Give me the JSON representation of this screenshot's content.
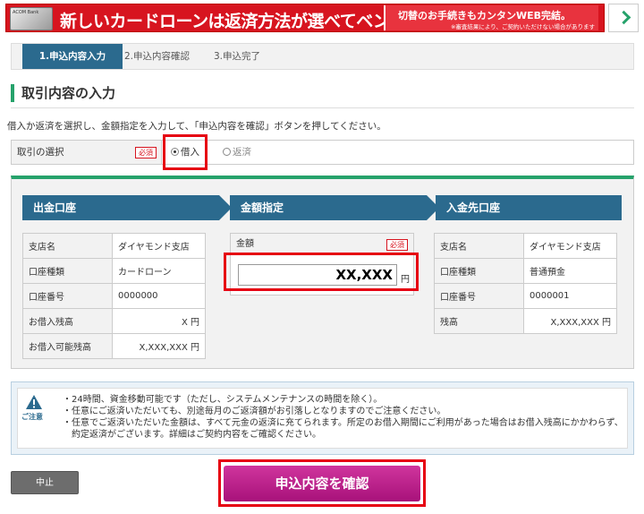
{
  "banner": {
    "card_text": "ACOM Bank",
    "headline": "新しいカードローンは返済方法が選べてベンリ！",
    "right_line1": "切替のお手続きもカンタンWEB完結。",
    "right_line2": "※審査結果により、ご契約いただけない場合があります"
  },
  "steps": [
    {
      "label": "1.申込内容入力"
    },
    {
      "label": "2.申込内容確認"
    },
    {
      "label": "3.申込完了"
    }
  ],
  "section_title": "取引内容の入力",
  "description": "借入か返済を選択し、金額指定を入力して、「申込内容を確認」ボタンを押してください。",
  "selection": {
    "label": "取引の選択",
    "required": "必須",
    "options": [
      {
        "label": "借入",
        "selected": true
      },
      {
        "label": "返済",
        "selected": false
      }
    ]
  },
  "withdraw": {
    "header": "出金口座",
    "rows": [
      {
        "key": "支店名",
        "value": "ダイヤモンド支店"
      },
      {
        "key": "口座種類",
        "value": "カードローン"
      },
      {
        "key": "口座番号",
        "value": "0000000"
      },
      {
        "key": "お借入残高",
        "value": "X 円"
      },
      {
        "key": "お借入可能残高",
        "value": "X,XXX,XXX 円"
      }
    ]
  },
  "amount": {
    "header": "金額指定",
    "label": "金額",
    "required": "必須",
    "value": "XX,XXX",
    "unit": "円"
  },
  "deposit": {
    "header": "入金先口座",
    "rows": [
      {
        "key": "支店名",
        "value": "ダイヤモンド支店"
      },
      {
        "key": "口座種類",
        "value": "普通預金"
      },
      {
        "key": "口座番号",
        "value": "0000001"
      },
      {
        "key": "残高",
        "value": "X,XXX,XXX 円"
      }
    ]
  },
  "notice": {
    "label": "ご注意",
    "items": [
      "・24時間、資金移動可能です（ただし、システムメンテナンスの時間を除く）。",
      "・任意にご返済いただいても、別途毎月のご返済額がお引落しとなりますのでご注意ください。",
      "・任意でご返済いただいた金額は、すべて元金の返済に充てられます。所定のお借入期間にご利用があった場合はお借入残高にかかわらず、約定返済がございます。詳細はご契約内容をご確認ください。"
    ]
  },
  "buttons": {
    "cancel": "中止",
    "confirm": "申込内容を確認"
  },
  "colors": {
    "accent_green": "#26a26b",
    "header_blue": "#2b6a8e",
    "highlight_red": "#e60012",
    "confirm_magenta": "#b51f86"
  }
}
